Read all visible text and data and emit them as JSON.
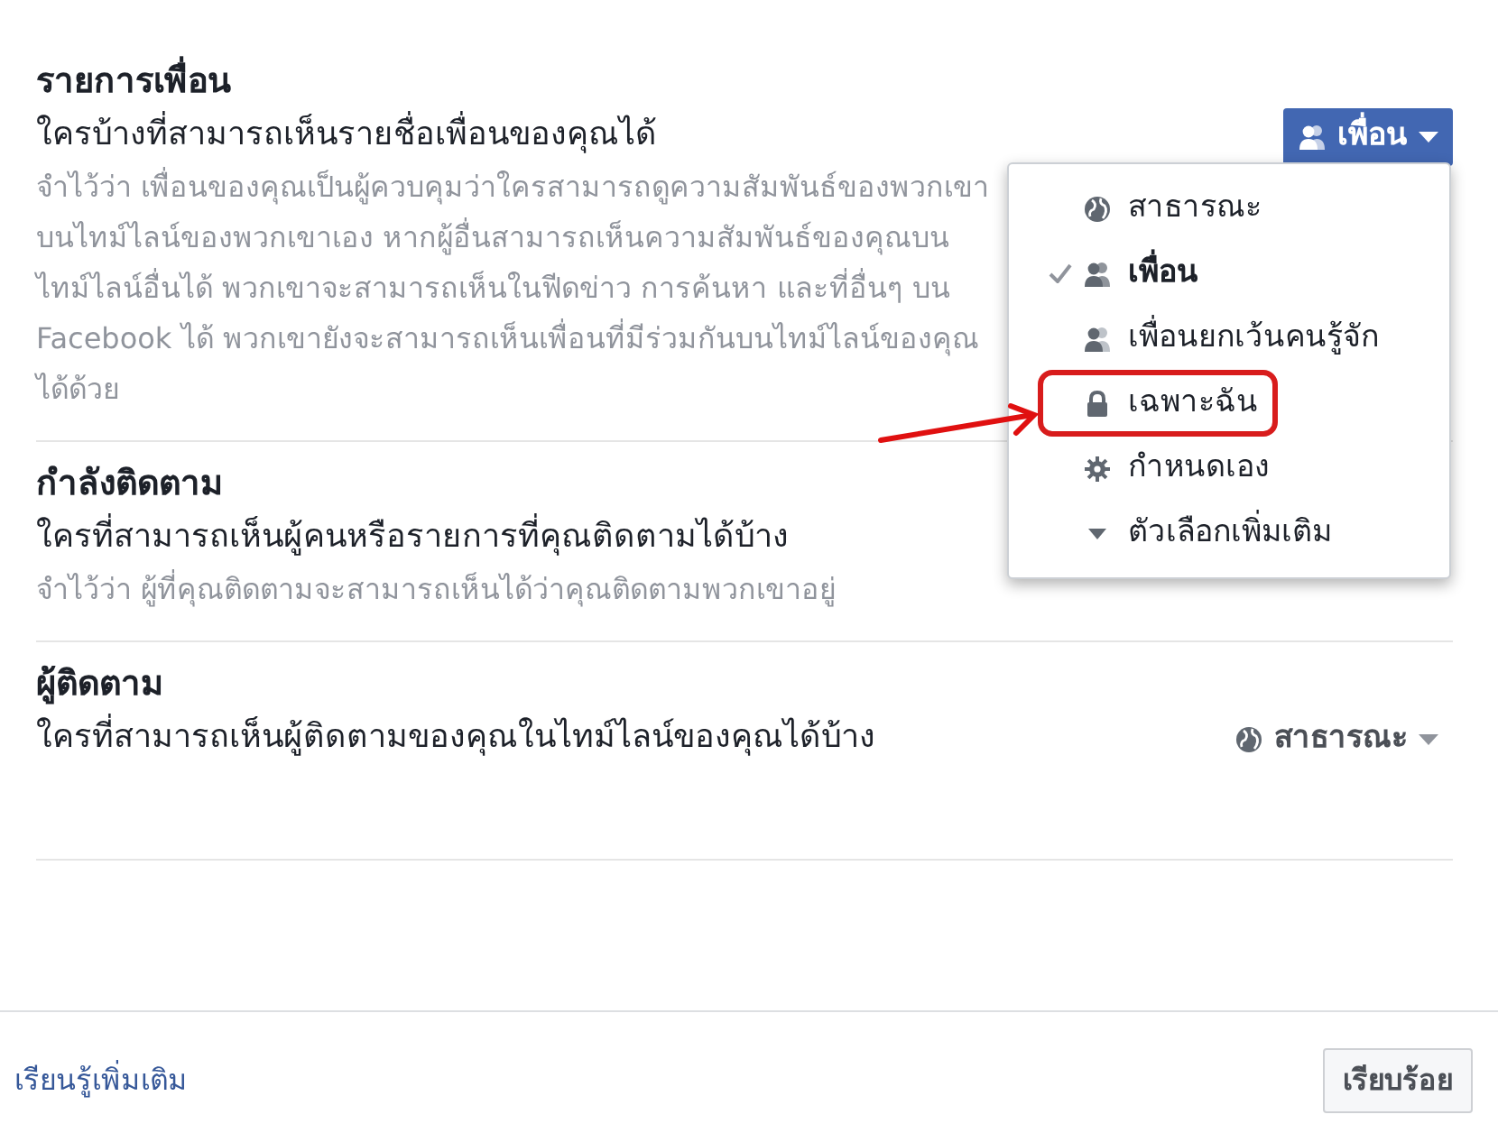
{
  "sections": [
    {
      "title": "รายการเพื่อน",
      "question": "ใครบ้างที่สามารถเห็นรายชื่อเพื่อนของคุณได้",
      "note": "จำไว้ว่า เพื่อนของคุณเป็นผู้ควบคุมว่าใครสามารถดูความสัมพันธ์ของพวกเขาบนไทม์ไลน์ของพวกเขาเอง หากผู้อื่นสามารถเห็นความสัมพันธ์ของคุณบนไทม์ไลน์อื่นได้ พวกเขาจะสามารถเห็นในฟีดข่าว การค้นหา และที่อื่นๆ บน Facebook ได้ พวกเขายังจะสามารถเห็นเพื่อนที่มีร่วมกันบนไทม์ไลน์ของคุณได้ด้วย",
      "selector": {
        "label": "เพื่อน",
        "kind": "friends",
        "open": true
      }
    },
    {
      "title": "กำลังติดตาม",
      "question": "ใครที่สามารถเห็นผู้คนหรือรายการที่คุณติดตามได้บ้าง",
      "note": "จำไว้ว่า ผู้ที่คุณติดตามจะสามารถเห็นได้ว่าคุณติดตามพวกเขาอยู่"
    },
    {
      "title": "ผู้ติดตาม",
      "question": "ใครที่สามารถเห็นผู้ติดตามของคุณในไทม์ไลน์ของคุณได้บ้าง",
      "selector": {
        "label": "สาธารณะ",
        "kind": "globe",
        "open": false
      }
    }
  ],
  "menu": {
    "options": [
      {
        "label": "สาธารณะ",
        "kind": "globe",
        "selected": false,
        "highlighted": false
      },
      {
        "label": "เพื่อน",
        "kind": "friends",
        "selected": true,
        "highlighted": false
      },
      {
        "label": "เพื่อนยกเว้นคนรู้จัก",
        "kind": "friends-except",
        "selected": false,
        "highlighted": false
      },
      {
        "label": "เฉพาะฉัน",
        "kind": "lock",
        "selected": false,
        "highlighted": true
      },
      {
        "label": "กำหนดเอง",
        "kind": "gear",
        "selected": false,
        "highlighted": false
      },
      {
        "label": "ตัวเลือกเพิ่มเติม",
        "kind": "more",
        "selected": false,
        "highlighted": false
      }
    ]
  },
  "footer": {
    "link": "เรียนรู้เพิ่มเติม",
    "button": "เรียบร้อย"
  }
}
